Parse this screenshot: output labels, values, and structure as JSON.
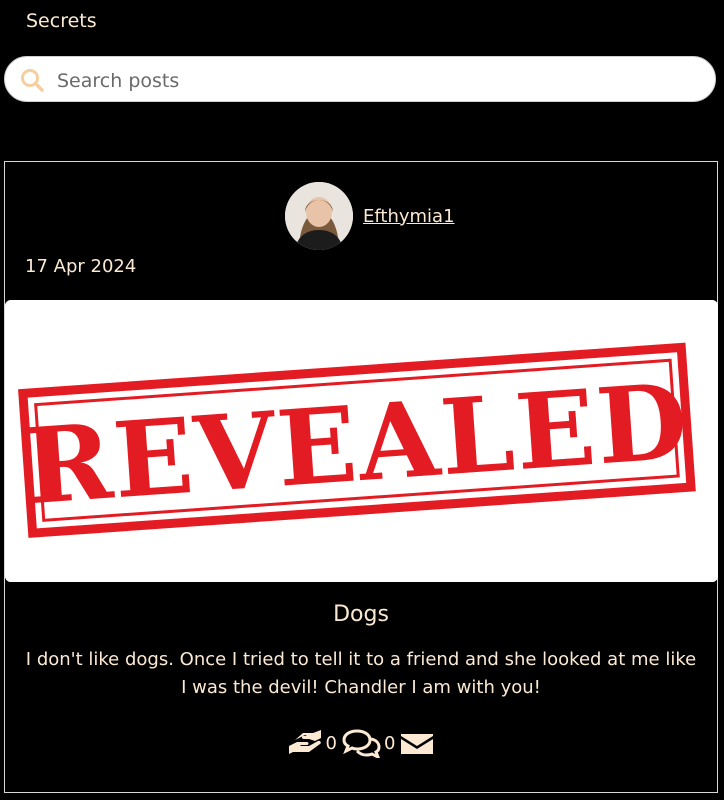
{
  "header": {
    "title": "Secrets"
  },
  "search": {
    "placeholder": "Search posts"
  },
  "post": {
    "author": "Efthymia1",
    "date": "17 Apr 2024",
    "image_text": "REVEALED",
    "title": "Dogs",
    "content": "I don't like dogs. Once I tried to tell it to a friend and she looked at me like I was the devil! Chandler I am with you!",
    "likes_count": "0",
    "comments_count": "0",
    "icons": {
      "like": "hands-helping-icon",
      "comments": "comments-icon",
      "message": "envelope-icon"
    }
  },
  "colors": {
    "background": "#000000",
    "text": "#fbe9d3",
    "stamp_red": "#e31b23",
    "search_icon": "#f5cfa0"
  }
}
